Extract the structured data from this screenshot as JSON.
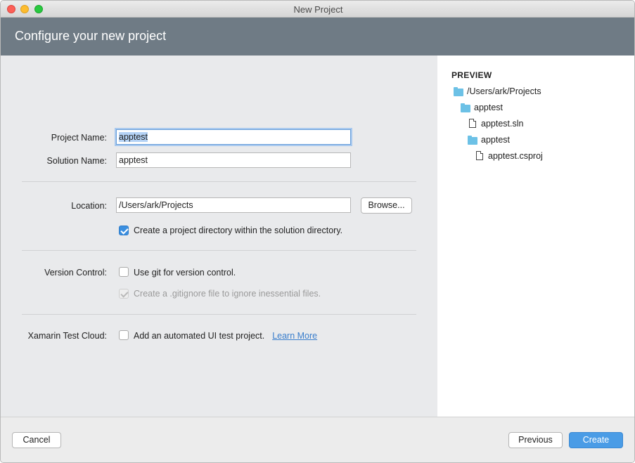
{
  "window": {
    "title": "New Project"
  },
  "header": {
    "title": "Configure your new project"
  },
  "form": {
    "project_name_label": "Project Name:",
    "project_name_value": "apptest",
    "solution_name_label": "Solution Name:",
    "solution_name_value": "apptest",
    "location_label": "Location:",
    "location_value": "/Users/ark/Projects",
    "browse_label": "Browse...",
    "create_dir_label": "Create a project directory within the solution directory.",
    "create_dir_checked": true,
    "version_control_label": "Version Control:",
    "use_git_label": "Use git for version control.",
    "use_git_checked": false,
    "gitignore_label": "Create a .gitignore file to ignore inessential files.",
    "gitignore_checked": true,
    "gitignore_enabled": false,
    "test_cloud_label": "Xamarin Test Cloud:",
    "test_cloud_option_label": "Add an automated UI test project.",
    "test_cloud_checked": false,
    "learn_more_label": "Learn More"
  },
  "preview": {
    "title": "PREVIEW",
    "tree": [
      {
        "type": "folder",
        "name": "/Users/ark/Projects",
        "depth": 0
      },
      {
        "type": "folder",
        "name": "apptest",
        "depth": 1
      },
      {
        "type": "file",
        "name": "apptest.sln",
        "depth": 2
      },
      {
        "type": "folder",
        "name": "apptest",
        "depth": 2
      },
      {
        "type": "file",
        "name": "apptest.csproj",
        "depth": 3
      }
    ]
  },
  "footer": {
    "cancel_label": "Cancel",
    "previous_label": "Previous",
    "create_label": "Create"
  },
  "colors": {
    "header_bg": "#6f7b85",
    "accent": "#4a9ce6",
    "folder": "#6cc1e6",
    "link": "#3a7ecc"
  }
}
